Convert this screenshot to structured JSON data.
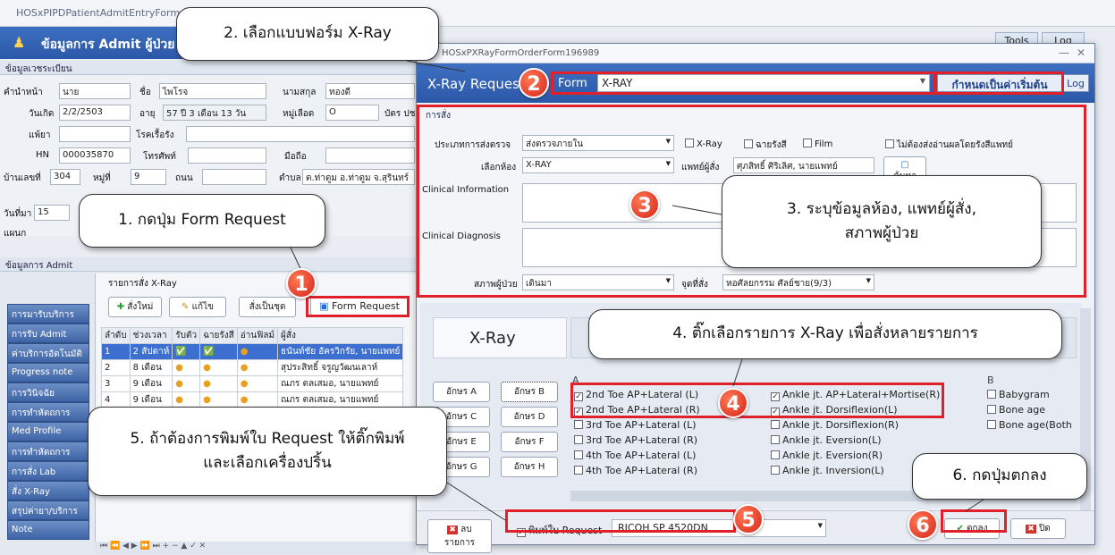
{
  "main_window": {
    "title": "HOSxPIPDPatientAdmitEntryForm",
    "header_title": "ข้อมูลการ Admit ผู้ป่วย",
    "tools_label": "Tools",
    "log_label": "Log"
  },
  "registration": {
    "section": "ข้อมูลเวชระเบียน",
    "prefix_label": "คำนำหน้า",
    "prefix_value": "นาย",
    "name_label": "ชื่อ",
    "name_value": "ไพโรจ",
    "surname_label": "นามสกุล",
    "surname_value": "ทองดี",
    "dob_label": "วันเกิด",
    "dob_value": "2/2/2503",
    "age_label": "อายุ",
    "age_value": "57 ปี 3 เดือน 13 วัน",
    "blood_label": "หมู่เลือด",
    "blood_value": "O",
    "card_label": "บัตร ปช",
    "allergy_label": "แพ้ยา",
    "chronic_label": "โรคเรื้อรัง",
    "hn_label": "HN",
    "hn_value": "000035870",
    "phone_label": "โทรศัพท์",
    "mobile_label": "มือถือ",
    "house_label": "บ้านเลขที่",
    "house_value": "304",
    "moo_label": "หมู่ที่",
    "moo_value": "9",
    "road_label": "ถนน",
    "tambon_label": "ตำบล",
    "tambon_value": "ต.ท่าตูม อ.ท่าตูม จ.สุรินทร์",
    "admit_date_label": "วันที่มา",
    "admit_date_value": "15",
    "ward_label": "แผนก"
  },
  "admit_section": {
    "title": "ข้อมูลการ Admit",
    "nav": [
      "การมารับบริการ",
      "การรับ Admit",
      "ค่าบริการอัตโนมัติ",
      "Progress note",
      "การวินิจฉัย",
      "การทำหัตถการ",
      "Med Profile",
      "การทำหัตถการ",
      "การสั่ง Lab",
      "สั่ง X-Ray",
      "สรุปค่ายา/บริการ",
      "Note"
    ],
    "xray_title": "รายการสั่ง X-Ray",
    "btn_new": "สั่งใหม่",
    "btn_edit": "แก้ไข",
    "btn_set": "สั่งเป็นชุด",
    "btn_form": "Form Request",
    "cols": [
      "ลำดับ",
      "ช่วงเวลา",
      "รับตัว",
      "ฉายรังสี",
      "อ่านฟิลม์",
      "ผู้สั่ง"
    ],
    "rows": [
      {
        "no": "1",
        "period": "2 สัปดาห์",
        "doctor": "ธนันท์ชัย อัครวิกรัย, นายแพทย์"
      },
      {
        "no": "2",
        "period": "8 เดือน",
        "doctor": "สุประสิทธิ์ จรูญวัฒนเลาห์"
      },
      {
        "no": "3",
        "period": "9 เดือน",
        "doctor": "ณภร ตลเสมอ, นายแพทย์"
      },
      {
        "no": "4",
        "period": "9 เดือน",
        "doctor": "ณภร ตลเสมอ, นายแพทย์"
      },
      {
        "no": "5",
        "period": "9 เดือน",
        "doctor": "ณภร ตลเสมอ, นายแพทย์"
      }
    ]
  },
  "dialog": {
    "title": "HOSxPXRayFormOrderForm196989",
    "header": "X-Ray Request",
    "form_label": "Form",
    "form_value": "X-RAY",
    "default_btn": "กำหนดเป็นค่าเริ่มต้น",
    "log_btn": "Log",
    "order_section": "การสั่ง",
    "order_type_label": "ประเภทการส่งตรวจ",
    "order_type_value": "ส่งตรวจภายใน",
    "chk_xray": "X-Ray",
    "chk_radiate": "ฉายรังสี",
    "chk_film": "Film",
    "chk_noread": "ไม่ต้องส่งอ่านผลโดยรังสีแพทย์",
    "room_label": "เลือกห้อง",
    "room_value": "X-RAY",
    "doctor_label": "แพทย์ผู้สั่ง",
    "doctor_value": "ศุภสิทธิ์ ศิริเลิศ, นายแพทย์",
    "search_btn": "ค้นหา",
    "clinical_info_label": "Clinical Information",
    "clinical_dx_label": "Clinical Diagnosis",
    "patient_status_label": "สภาพผู้ป่วย",
    "patient_status_value": "เดินมา",
    "order_point_label": "จุดที่สั่ง",
    "order_point_value": "หอศัลยกรรม ศัลย์ชาย(9/3)",
    "panel_title": "X-Ray",
    "letters": [
      "อักษร A",
      "อักษร B",
      "อักษร C",
      "อักษร D",
      "อักษร E",
      "อักษร F",
      "อักษร G",
      "อักษร H"
    ],
    "col_a": "A",
    "col_b": "B",
    "items_a1": [
      {
        "t": "2nd Toe AP+Lateral (L)",
        "c": true
      },
      {
        "t": "2nd Toe AP+Lateral (R)",
        "c": true
      },
      {
        "t": "3rd Toe AP+Lateral (L)",
        "c": false
      },
      {
        "t": "3rd Toe AP+Lateral (R)",
        "c": false
      },
      {
        "t": "4th Toe AP+Lateral (L)",
        "c": false
      },
      {
        "t": "4th Toe AP+Lateral (R)",
        "c": false
      }
    ],
    "items_a2": [
      {
        "t": "Ankle jt. AP+Lateral+Mortise(R)",
        "c": true
      },
      {
        "t": "Ankle jt. Dorsiflexion(L)",
        "c": true
      },
      {
        "t": "Ankle jt. Dorsiflexion(R)",
        "c": false
      },
      {
        "t": "Ankle jt. Eversion(L)",
        "c": false
      },
      {
        "t": "Ankle jt. Eversion(R)",
        "c": false
      },
      {
        "t": "Ankle jt. Inversion(L)",
        "c": false
      }
    ],
    "items_b": [
      {
        "t": "Babygram",
        "c": false
      },
      {
        "t": "Bone age",
        "c": false
      },
      {
        "t": "Bone age(Both",
        "c": false
      }
    ],
    "delete_btn": "ลบรายการ",
    "print_label": "พิมพ์ใบ Request",
    "printer_value": "RICOH SP 4520DN",
    "ok_btn": "ตกลง",
    "close_btn": "ปิด"
  },
  "callouts": {
    "c1": "1. กดปุ่ม Form Request",
    "c2": "2. เลือกแบบฟอร์ม X-Ray",
    "c3a": "3. ระบุข้อมูลห้อง, แพทย์ผู้สั่ง,",
    "c3b": "สภาพผู้ป่วย",
    "c4": "4. ติ๊กเลือกรายการ X-Ray เพื่อสั่งหลายรายการ",
    "c5a": "5. ถ้าต้องการพิมพ์ใบ Request ให้ติ๊กพิมพ์",
    "c5b": "และเลือกเครื่องปริ้น",
    "c6": "6. กดปุ่มตกลง"
  },
  "badges": [
    "1",
    "2",
    "3",
    "4",
    "5",
    "6"
  ]
}
